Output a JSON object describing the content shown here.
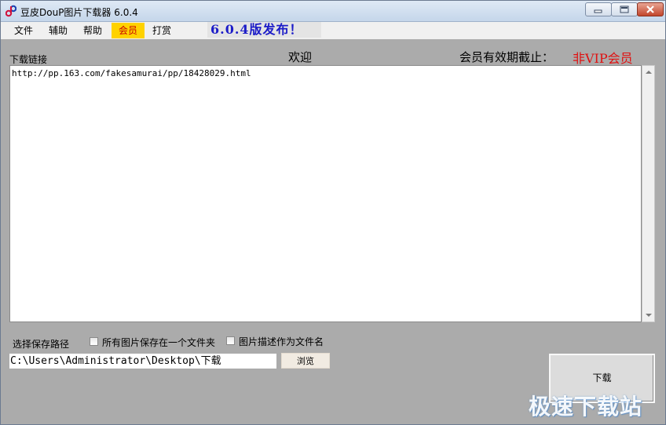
{
  "window": {
    "title": "豆皮DouP图片下载器 6.0.4"
  },
  "menu": {
    "items": [
      {
        "label": "文件"
      },
      {
        "label": "辅助"
      },
      {
        "label": "帮助"
      },
      {
        "label": "会员"
      },
      {
        "label": "打赏"
      }
    ],
    "release_notice": "6.0.4版发布！"
  },
  "main": {
    "links_label": "下载链接",
    "welcome": "欢迎",
    "membership_label": "会员有效期截止：",
    "membership_status": "非VIP会员",
    "links_text": "http://pp.163.com/fakesamurai/pp/18428029.html"
  },
  "save": {
    "label": "选择保存路径",
    "checkbox_single_folder": "所有图片保存在一个文件夹",
    "checkbox_desc_filename": "图片描述作为文件名",
    "path": "C:\\Users\\Administrator\\Desktop\\下载",
    "browse": "浏览"
  },
  "download_button": "下载",
  "watermark": "极速下载站",
  "colors": {
    "highlight": "#ffd200",
    "vip_red": "#e01010",
    "release_blue": "#1c1cc8"
  }
}
